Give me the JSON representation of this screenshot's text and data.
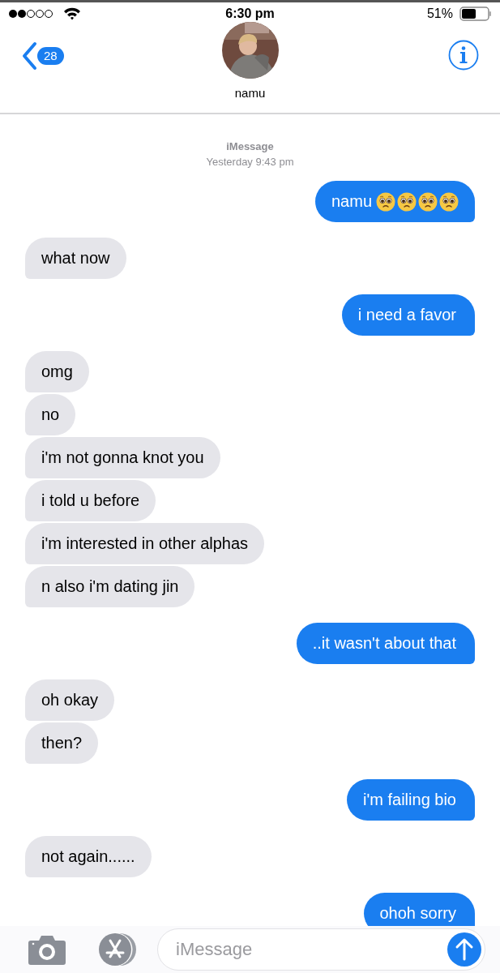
{
  "status_bar": {
    "time": "6:30 pm",
    "battery": "51%"
  },
  "header": {
    "back_badge": "28",
    "contact_name": "namu"
  },
  "thread": {
    "service": "iMessage",
    "timestamp": "Yesterday 9:43 pm"
  },
  "messages": [
    {
      "kind": "sent",
      "text": "namu",
      "emoji": [
        {
          "kind": "pleading"
        },
        {
          "kind": "pleading"
        },
        {
          "kind": "pleading"
        },
        {
          "kind": "pleading"
        }
      ]
    },
    {
      "kind": "received",
      "text": "what now"
    },
    {
      "kind": "sent",
      "text": "i need a favor"
    },
    {
      "kind": "received",
      "text": "omg"
    },
    {
      "kind": "received",
      "text": "no"
    },
    {
      "kind": "received",
      "text": "i'm not gonna knot you"
    },
    {
      "kind": "received",
      "text": "i told u before"
    },
    {
      "kind": "received",
      "text": "i'm interested in other alphas"
    },
    {
      "kind": "received",
      "text": "n also i'm dating jin"
    },
    {
      "kind": "sent",
      "text": "..it wasn't about that"
    },
    {
      "kind": "received",
      "text": "oh okay"
    },
    {
      "kind": "received",
      "text": "then?"
    },
    {
      "kind": "sent",
      "text": "i'm failing bio"
    },
    {
      "kind": "received",
      "text": "not again......"
    },
    {
      "kind": "sent",
      "text": "ohoh sorry"
    }
  ],
  "composer": {
    "placeholder": "iMessage"
  }
}
